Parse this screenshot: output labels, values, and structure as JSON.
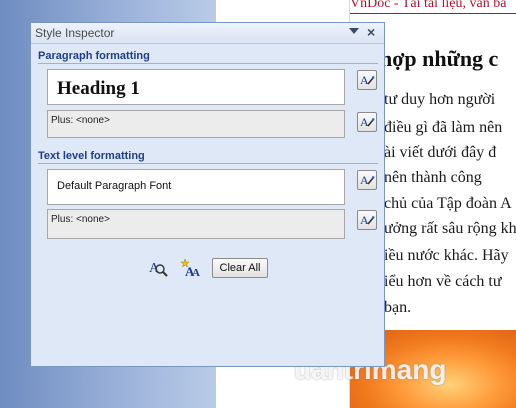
{
  "document": {
    "header_text": "VnDoc - Tài tài liệu, văn bả",
    "heading": "hợp những c",
    "lines": [
      "tư duy hơn người",
      "điều gì đã làm nên",
      "ài viết dưới đây đ",
      "nên thành công",
      "chủ của Tập đoàn A",
      "ưởng rất sâu rộng kh",
      "iều nước khác. Hãy",
      "iểu hơn về cách tư",
      "bạn."
    ]
  },
  "watermark": {
    "text": "uantrimang",
    "logo_icon": "q-logo-icon"
  },
  "style_inspector": {
    "title": "Style Inspector",
    "dropdown_icon": "chevron-down-icon",
    "close_label": "×",
    "paragraph_section": {
      "heading": "Paragraph formatting",
      "style_value": "Heading 1",
      "plus_value": "Plus: <none>"
    },
    "text_section": {
      "heading": "Text level formatting",
      "style_value": "Default Paragraph Font",
      "plus_value": "Plus: <none>"
    },
    "buttons": {
      "reveal_formatting_icon": "reveal-formatting-icon",
      "new_style_icon": "new-style-icon",
      "clear_all_label": "Clear All"
    }
  },
  "colors": {
    "section_heading": "#1f3e8a",
    "panel_bg": "#dfe8f6",
    "doc_header": "#b3122d"
  }
}
